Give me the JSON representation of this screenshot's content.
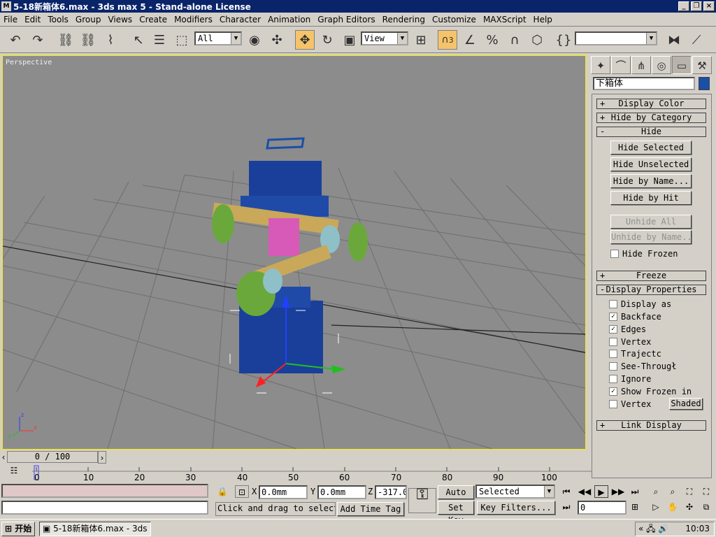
{
  "window": {
    "title": "5-18新箱体6.max - 3ds max 5 - Stand-alone License",
    "app_icon": "3ds-max-icon"
  },
  "menu": [
    "File",
    "Edit",
    "Tools",
    "Group",
    "Views",
    "Create",
    "Modifiers",
    "Character",
    "Animation",
    "Graph Editors",
    "Rendering",
    "Customize",
    "MAXScript",
    "Help"
  ],
  "toolbar": {
    "selection_filter": "All",
    "ref_coord": "View",
    "snap_value": "3",
    "named_selection": ""
  },
  "viewport": {
    "label": "Perspective",
    "gizmo_axes": [
      "x",
      "y",
      "z"
    ]
  },
  "command_panel": {
    "object_name": "下箱体",
    "object_color": "#1a4fa8",
    "rollouts": {
      "display_color": "Display Color",
      "hide_by_category": "Hide by Category",
      "hide": "Hide",
      "freeze": "Freeze",
      "display_properties": "Display Properties",
      "link_display": "Link Display"
    },
    "hide_buttons": {
      "hide_selected": "Hide Selected",
      "hide_unselected": "Hide Unselected",
      "hide_by_name": "Hide by Name...",
      "hide_by_hit": "Hide by Hit",
      "unhide_all": "Unhide All",
      "unhide_by_name": "Unhide by Name..."
    },
    "hide_frozen": "Hide Frozen",
    "display_props": [
      {
        "label": "Display as",
        "checked": false
      },
      {
        "label": "Backface",
        "checked": true
      },
      {
        "label": "Edges",
        "checked": true
      },
      {
        "label": "Vertex",
        "checked": false
      },
      {
        "label": "Trajectc",
        "checked": false
      },
      {
        "label": "See-Througł",
        "checked": false
      },
      {
        "label": "Ignore",
        "checked": false
      },
      {
        "label": "Show Frozen in",
        "checked": true
      },
      {
        "label": "Vertex",
        "checked": false
      }
    ],
    "shaded_button": "Shaded"
  },
  "timeline": {
    "frame": "0 / 100",
    "ticks": [
      "0",
      "10",
      "20",
      "30",
      "40",
      "50",
      "60",
      "70",
      "80",
      "90",
      "100"
    ]
  },
  "status": {
    "prompt": "Click and drag to select",
    "add_time_tag": "Add Time Tag",
    "x_label": "X",
    "x_value": "0.0mm",
    "y_label": "Y",
    "y_value": "0.0mm",
    "z_label": "Z",
    "z_value": "-317.0",
    "auto_key": "Auto Key",
    "set_key": "Set Key",
    "key_mode": "Selected",
    "key_filters": "Key Filters...",
    "current_frame": "0"
  },
  "taskbar": {
    "start": "开始",
    "task_item": "5-18新箱体6.max - 3ds ...",
    "time": "10:03"
  }
}
